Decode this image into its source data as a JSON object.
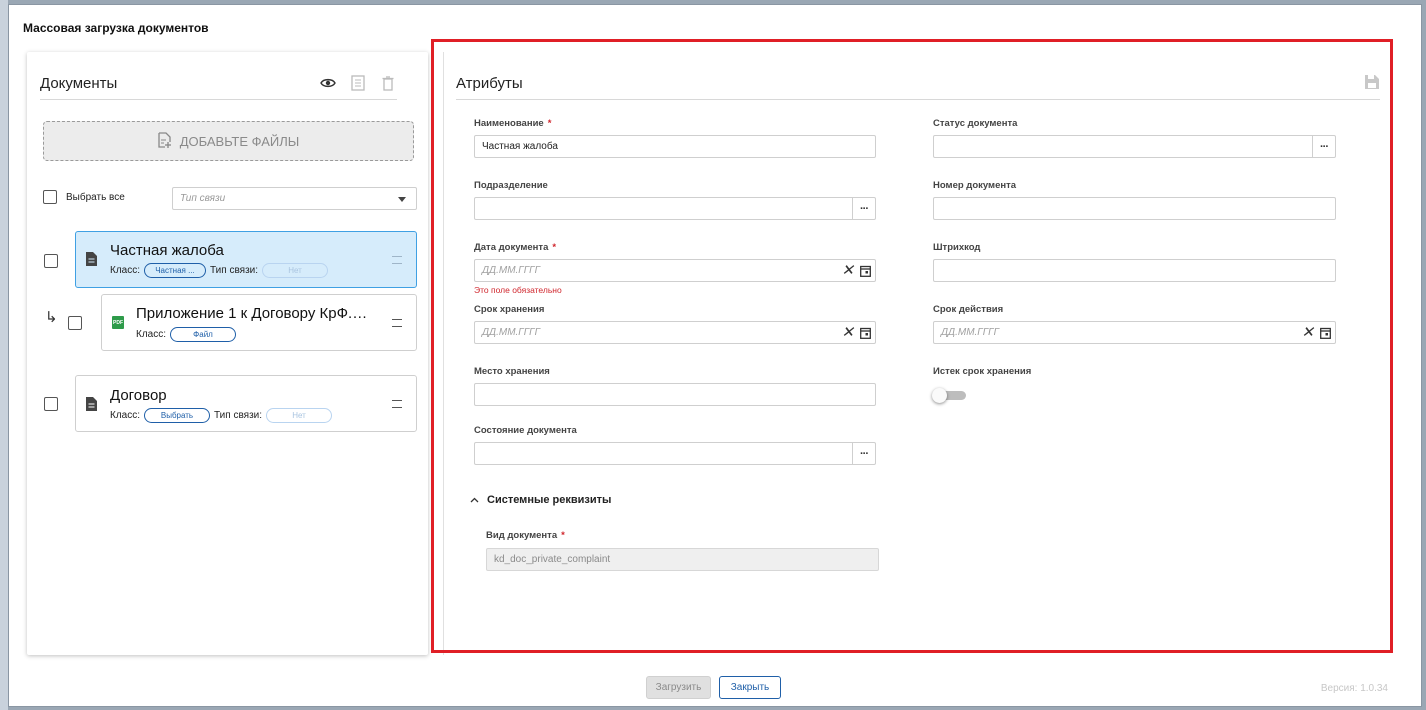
{
  "window": {
    "title": "Массовая загрузка документов"
  },
  "documents_panel": {
    "title": "Документы",
    "add_files_label": "ДОБАВЬТЕ ФАЙЛЫ",
    "select_all_label": "Выбрать все",
    "link_type_placeholder": "Тип связи",
    "items": [
      {
        "name": "Частная жалоба",
        "class_label": "Класс:",
        "class_value": "Частная ...",
        "link_label": "Тип связи:",
        "link_value": "Нет",
        "selected": true
      },
      {
        "name": "Приложение 1 к Договору КрФ.4...",
        "class_label": "Класс:",
        "class_value": "Файл",
        "file_type": "PDF",
        "child": true
      },
      {
        "name": "Договор",
        "class_label": "Класс:",
        "class_value": "Выбрать",
        "link_label": "Тип связи:",
        "link_value": "Нет"
      }
    ]
  },
  "attributes_panel": {
    "title": "Атрибуты",
    "fields": {
      "name": {
        "label": "Наименование",
        "value": "Частная жалоба"
      },
      "department": {
        "label": "Подразделение",
        "value": ""
      },
      "doc_date": {
        "label": "Дата документа",
        "placeholder": "ДД.ММ.ГГГГ",
        "error": "Это поле обязательно"
      },
      "storage_period": {
        "label": "Срок хранения",
        "placeholder": "ДД.ММ.ГГГГ"
      },
      "storage_place": {
        "label": "Место хранения",
        "value": ""
      },
      "doc_state": {
        "label": "Состояние документа",
        "value": ""
      },
      "doc_status": {
        "label": "Статус документа",
        "value": ""
      },
      "doc_number": {
        "label": "Номер документа",
        "value": ""
      },
      "barcode": {
        "label": "Штрихкод",
        "value": ""
      },
      "validity": {
        "label": "Срок действия",
        "placeholder": "ДД.ММ.ГГГГ"
      },
      "storage_expired": {
        "label": "Истек срок хранения",
        "value": false
      }
    },
    "system_section": {
      "title": "Системные реквизиты",
      "doc_kind_label": "Вид документа",
      "doc_kind_value": "kd_doc_private_complaint"
    }
  },
  "footer": {
    "upload_label": "Загрузить",
    "close_label": "Закрыть",
    "version": "Версия: 1.0.34"
  },
  "colors": {
    "accent": "#1f5fa8",
    "highlight_frame": "#e01f26",
    "selected_bg": "#d6ecfb",
    "error": "#d0262d"
  }
}
